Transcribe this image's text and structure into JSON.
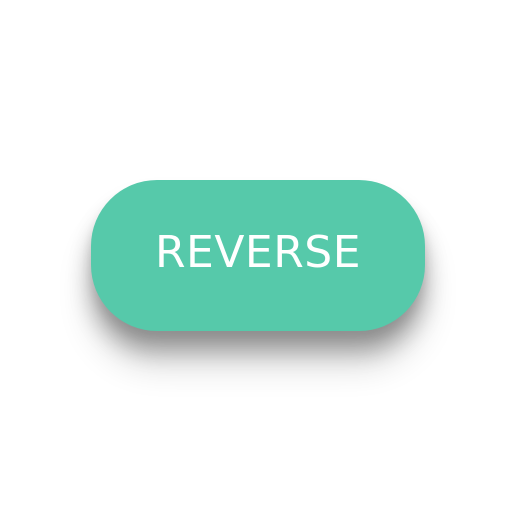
{
  "button": {
    "label": "REVERSE",
    "color": "#56c9aa",
    "text_color": "#ffffff"
  }
}
